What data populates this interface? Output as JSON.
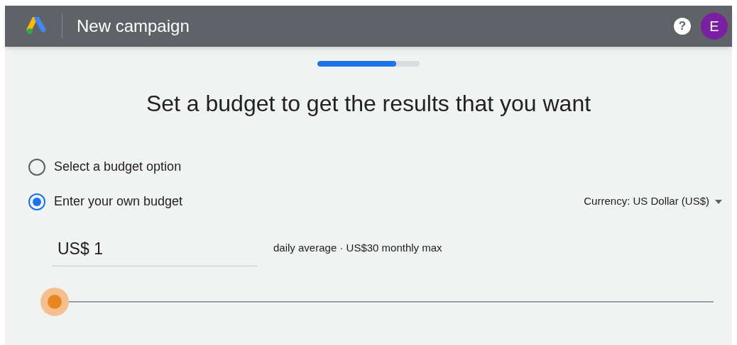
{
  "header": {
    "title": "New campaign",
    "help": "?",
    "avatar": "E"
  },
  "progress": {
    "level": 0.77
  },
  "heading": "Set a budget to get the results that you want",
  "options": [
    {
      "label": "Select a budget option",
      "selected": false
    },
    {
      "label": "Enter your own budget",
      "selected": true
    }
  ],
  "currency": "Currency: US Dollar (US$)",
  "budget": {
    "value": "US$ 1",
    "note": "daily average · US$30 monthly max"
  }
}
